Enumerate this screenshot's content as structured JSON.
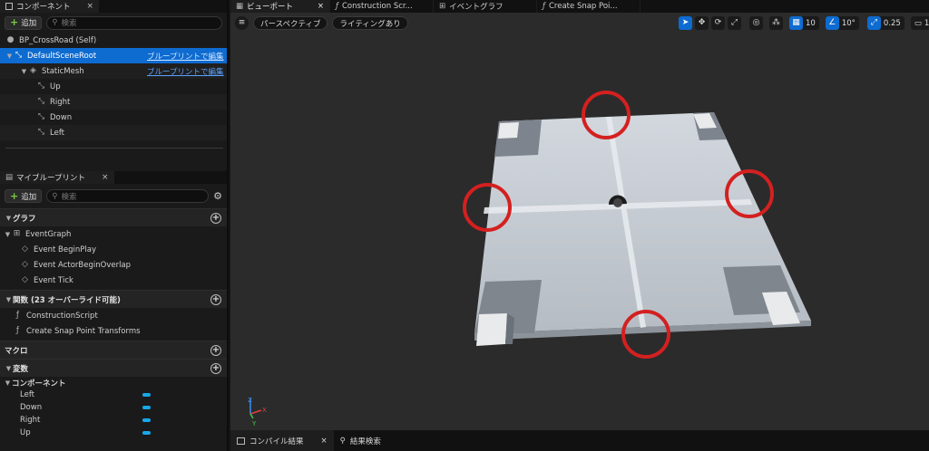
{
  "components_panel": {
    "tab_label": "コンポーネント",
    "add_label": "追加",
    "search_placeholder": "検索",
    "tree": [
      {
        "label": "BP_CrossRoad (Self)",
        "link": ""
      },
      {
        "label": "DefaultSceneRoot",
        "link": "ブループリントで編集"
      },
      {
        "label": "StaticMesh",
        "link": "ブループリントで編集"
      },
      {
        "label": "Up",
        "link": ""
      },
      {
        "label": "Right",
        "link": ""
      },
      {
        "label": "Down",
        "link": ""
      },
      {
        "label": "Left",
        "link": ""
      }
    ]
  },
  "my_blueprint_panel": {
    "tab_label": "マイブループリント",
    "add_label": "追加",
    "search_placeholder": "検索",
    "graph_section": "グラフ",
    "event_graph": "EventGraph",
    "events": [
      "Event BeginPlay",
      "Event ActorBeginOverlap",
      "Event Tick"
    ],
    "functions_section": "関数 (23 オーバーライド可能)",
    "functions": [
      "ConstructionScript",
      "Create Snap Point Transforms"
    ],
    "macros_section": "マクロ",
    "variables_section": "変数",
    "components_category": "コンポーネント",
    "variables": [
      "Left",
      "Down",
      "Right",
      "Up"
    ]
  },
  "viewport": {
    "tabs": [
      {
        "label": "ビューポート"
      },
      {
        "label": "Construction Scr..."
      },
      {
        "label": "イベントグラフ"
      },
      {
        "label": "Create Snap Poi..."
      }
    ],
    "perspective_label": "パースペクティブ",
    "lighting_label": "ライティングあり",
    "grid_snap_value": "10",
    "rotation_snap_value": "10°",
    "scale_snap_value": "0.25",
    "camera_speed_value": "1",
    "axis_labels": {
      "x": "X",
      "y": "Y",
      "z": "Z"
    }
  },
  "bottom_bar": {
    "compile_results_label": "コンパイル結果",
    "find_results_label": "結果検索"
  },
  "colors": {
    "selection_blue": "#0e6bd0",
    "link_blue": "#5aa0ff",
    "highlight_circle": "#d42020",
    "variable_pill": "#19a7e8"
  }
}
